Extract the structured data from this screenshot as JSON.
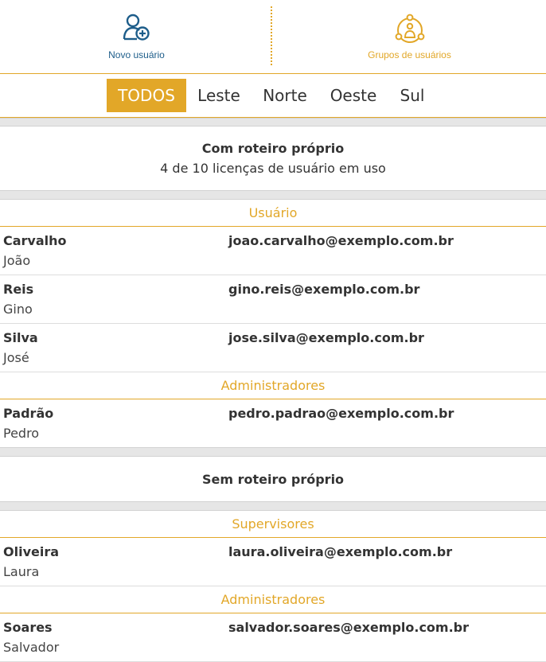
{
  "toolbar": {
    "new_user_label": "Novo usuário",
    "groups_label": "Grupos de usuários",
    "new_user_icon": "add-user-icon",
    "groups_icon": "user-group-icon"
  },
  "tabs": [
    {
      "label": "TODOS",
      "active": true
    },
    {
      "label": "Leste",
      "active": false
    },
    {
      "label": "Norte",
      "active": false
    },
    {
      "label": "Oeste",
      "active": false
    },
    {
      "label": "Sul",
      "active": false
    }
  ],
  "sections": [
    {
      "title": "Com roteiro próprio",
      "subtitle": "4 de 10 licenças de usuário em uso",
      "groups": [
        {
          "name": "Usuário",
          "users": [
            {
              "last": "Carvalho",
              "first": "João",
              "email": "joao.carvalho@exemplo.com.br"
            },
            {
              "last": "Reis",
              "first": "Gino",
              "email": "gino.reis@exemplo.com.br"
            },
            {
              "last": "Silva",
              "first": "José",
              "email": "jose.silva@exemplo.com.br"
            }
          ]
        },
        {
          "name": "Administradores",
          "users": [
            {
              "last": "Padrão",
              "first": "Pedro",
              "email": "pedro.padrao@exemplo.com.br"
            }
          ]
        }
      ]
    },
    {
      "title": "Sem roteiro próprio",
      "groups": [
        {
          "name": "Supervisores",
          "users": [
            {
              "last": "Oliveira",
              "first": "Laura",
              "email": "laura.oliveira@exemplo.com.br"
            }
          ]
        },
        {
          "name": "Administradores",
          "users": [
            {
              "last": "Soares",
              "first": "Salvador",
              "email": "salvador.soares@exemplo.com.br"
            }
          ]
        }
      ]
    }
  ],
  "colors": {
    "accent": "#e2a728",
    "brand_blue": "#1d5d8a",
    "separator": "#e6e6e6"
  }
}
